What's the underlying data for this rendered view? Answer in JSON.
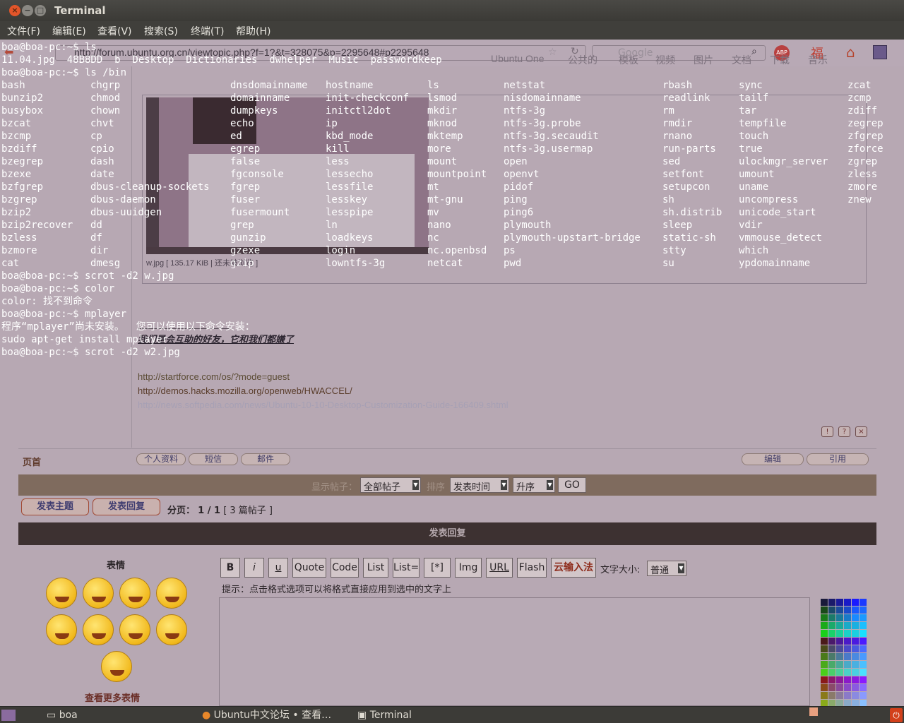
{
  "window": {
    "title": "Terminal",
    "close_label": "×",
    "min_label": "−",
    "max_label": "□"
  },
  "menubar": [
    "文件(F)",
    "编辑(E)",
    "查看(V)",
    "搜索(S)",
    "终端(T)",
    "帮助(H)"
  ],
  "browser": {
    "url": "http://forum.ubuntu.org.cn/viewtopic.php?f=1?&t=328075&p=2295648#p2295648",
    "search_placeholder": "Google",
    "bookmarks": [
      "Ubuntu One",
      "公共的",
      "模板",
      "视频",
      "图片",
      "文档",
      "下载",
      "音乐"
    ]
  },
  "post": {
    "image_caption": "w.jpg [ 135.17 KiB | 还未被浏览 ]",
    "signature": "我们是会互助的好友，它和我们都嫌了",
    "links": [
      "http://startforce.com/os/?mode=guest",
      "http://demos.hacks.mozilla.org/openweb/HWACCEL/",
      "http://news.softpedia.com/news/Ubuntu-10-10-Desktop-Customization-Guide-166409.shtml"
    ],
    "top_label": "页首",
    "profile_buttons": [
      "个人资料",
      "短信",
      "邮件"
    ],
    "edit_buttons": [
      "编辑",
      "引用"
    ]
  },
  "filter": {
    "show_label": "显示帖子：",
    "show_value": "全部帖子",
    "sort_label": "排序",
    "sort_value": "发表时间",
    "order_value": "升序",
    "go_label": "GO"
  },
  "actions": {
    "new_topic": "发表主题",
    "reply": "发表回复",
    "pagination_label": "分页：",
    "pagination_value": "1 / 1",
    "post_count": "[ 3 篇帖子 ]"
  },
  "reply_form": {
    "header": "发表回复",
    "emoji_title": "表情",
    "more_emoji": "查看更多表情",
    "format_buttons": [
      "B",
      "i",
      "u",
      "Quote",
      "Code",
      "List",
      "List=",
      "[*]",
      "Img",
      "URL",
      "Flash",
      "云输入法"
    ],
    "fontsize_label": "文字大小:",
    "fontsize_value": "普通",
    "hint": "提示：点击格式选项可以将格式直接应用到选中的文字上"
  },
  "terminal": {
    "lines": [
      "boa@boa-pc:~$ ls",
      "11.04.jpg  48B8DD  b  Desktop  Dictionaries  dwhelper  Music  passwordkeep",
      "boa@boa-pc:~$ ls /bin"
    ],
    "bin_columns": [
      [
        "bash",
        "bunzip2",
        "busybox",
        "bzcat",
        "bzcmp",
        "bzdiff",
        "bzegrep",
        "bzexe",
        "bzfgrep",
        "bzgrep",
        "bzip2",
        "bzip2recover",
        "bzless",
        "bzmore",
        "cat"
      ],
      [
        "chgrp",
        "chmod",
        "chown",
        "chvt",
        "cp",
        "cpio",
        "dash",
        "date",
        "dbus-cleanup-sockets",
        "dbus-daemon",
        "dbus-uuidgen",
        "dd",
        "df",
        "dir",
        "dmesg"
      ],
      [
        "dnsdomainname",
        "domainname",
        "dumpkeys",
        "echo",
        "ed",
        "egrep",
        "false",
        "fgconsole",
        "fgrep",
        "fuser",
        "fusermount",
        "grep",
        "gunzip",
        "gzexe",
        "gzip"
      ],
      [
        "hostname",
        "init-checkconf",
        "initctl2dot",
        "ip",
        "kbd_mode",
        "kill",
        "less",
        "lessecho",
        "lessfile",
        "lesskey",
        "lesspipe",
        "ln",
        "loadkeys",
        "login",
        "lowntfs-3g"
      ],
      [
        "ls",
        "lsmod",
        "mkdir",
        "mknod",
        "mktemp",
        "more",
        "mount",
        "mountpoint",
        "mt",
        "mt-gnu",
        "mv",
        "nano",
        "nc",
        "nc.openbsd",
        "netcat"
      ],
      [
        "netstat",
        "nisdomainname",
        "ntfs-3g",
        "ntfs-3g.probe",
        "ntfs-3g.secaudit",
        "ntfs-3g.usermap",
        "open",
        "openvt",
        "pidof",
        "ping",
        "ping6",
        "plymouth",
        "plymouth-upstart-bridge",
        "ps",
        "pwd"
      ],
      [
        "rbash",
        "readlink",
        "rm",
        "rmdir",
        "rnano",
        "run-parts",
        "sed",
        "setfont",
        "setupcon",
        "sh",
        "sh.distrib",
        "sleep",
        "static-sh",
        "stty",
        "su"
      ],
      [
        "sync",
        "tailf",
        "tar",
        "tempfile",
        "touch",
        "true",
        "ulockmgr_server",
        "umount",
        "uname",
        "uncompress",
        "unicode_start",
        "vdir",
        "vmmouse_detect",
        "which",
        "ypdomainname"
      ],
      [
        "zcat",
        "zcmp",
        "zdiff",
        "zegrep",
        "zfgrep",
        "zforce",
        "zgrep",
        "zless",
        "zmore",
        "znew"
      ]
    ],
    "after": [
      "boa@boa-pc:~$ scrot -d2 w.jpg",
      "boa@boa-pc:~$ color",
      "color: 找不到命令",
      "boa@boa-pc:~$ mplayer",
      "程序“mplayer”尚未安装。  您可以使用以下命令安装：",
      "sudo apt-get install mplayer",
      "boa@boa-pc:~$ scrot -d2 w2.jpg"
    ]
  },
  "taskbar": {
    "items": [
      "boa",
      "Ubuntu中文论坛 • 查看…",
      "Terminal"
    ]
  }
}
